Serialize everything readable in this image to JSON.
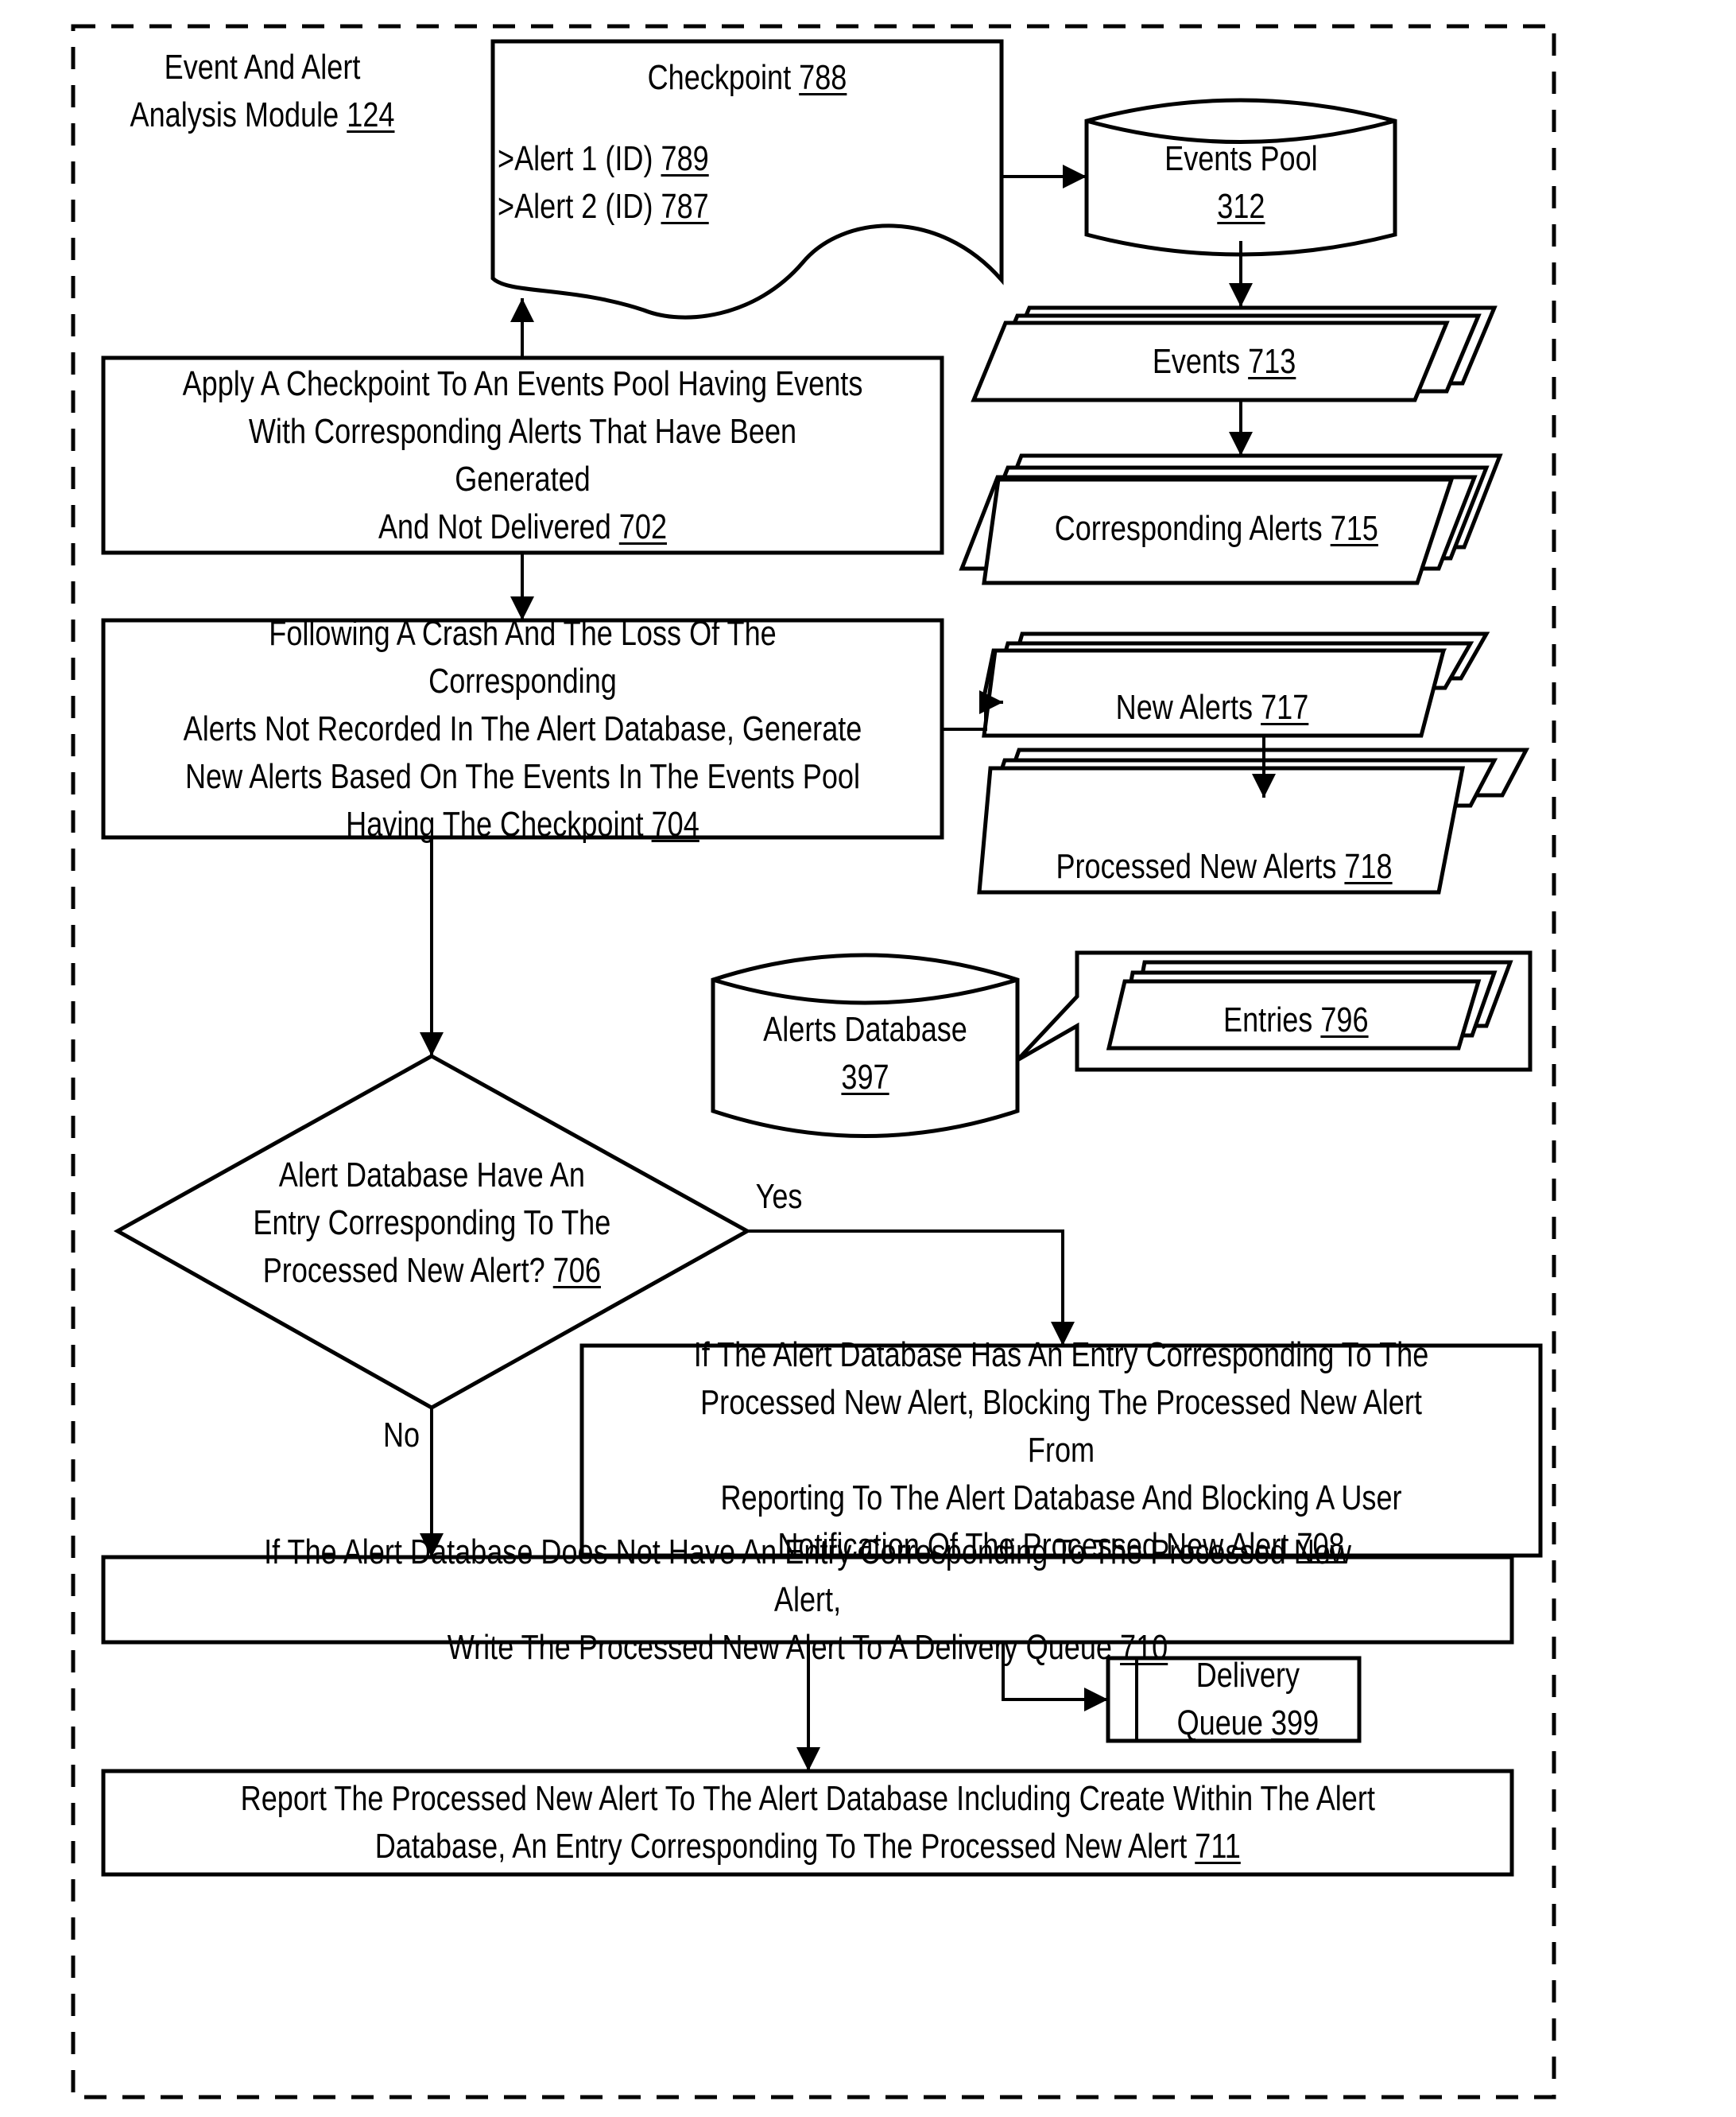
{
  "module": {
    "title_line1": "Event And Alert",
    "title_line2": "Analysis Module",
    "ref": "124"
  },
  "checkpoint": {
    "title": "Checkpoint",
    "ref": "788",
    "items": [
      {
        "label": ">Alert 1 (ID)",
        "ref": "789"
      },
      {
        "label": ">Alert 2 (ID)",
        "ref": "787"
      }
    ]
  },
  "events_pool": {
    "label": "Events Pool",
    "ref": "312"
  },
  "events": {
    "label": "Events",
    "ref": "713"
  },
  "corresponding_alerts": {
    "label": "Corresponding Alerts",
    "ref": "715"
  },
  "new_alerts": {
    "label": "New Alerts",
    "ref": "717"
  },
  "processed_new_alerts": {
    "label": "Processed New Alerts",
    "ref": "718"
  },
  "alerts_database": {
    "label": "Alerts Database",
    "ref": "397"
  },
  "entries": {
    "label": "Entries",
    "ref": "796"
  },
  "steps": {
    "s702": {
      "text": "Apply A Checkpoint To An Events Pool Having Events\nWith Corresponding Alerts That Have Been Generated\nAnd Not Delivered",
      "ref": "702"
    },
    "s704": {
      "text": "Following A Crash And The Loss Of The Corresponding\nAlerts Not Recorded In The Alert Database, Generate\nNew Alerts Based On The Events In The Events Pool\nHaving The Checkpoint",
      "ref": "704"
    },
    "s706": {
      "text": "Alert Database Have An\nEntry Corresponding To The\nProcessed New Alert?",
      "ref": "706"
    },
    "s708": {
      "text": "If The Alert Database Has An Entry Corresponding To The\nProcessed New Alert, Blocking The Processed New Alert From\nReporting To The Alert Database And Blocking A User\nNotification Of The Processed New Alert",
      "ref": "708"
    },
    "s710": {
      "text": "If The Alert Database Does Not Have An Entry Corresponding To The Processed New Alert,\nWrite The Processed New Alert To A Delivery Queue",
      "ref": "710"
    },
    "s711": {
      "text": "Report The Processed New Alert To The Alert Database Including Create Within The Alert\nDatabase, An Entry Corresponding To The Processed New Alert",
      "ref": "711"
    }
  },
  "branches": {
    "yes": "Yes",
    "no": "No"
  },
  "delivery_queue": {
    "line1": "Delivery",
    "line2": "Queue",
    "ref": "399"
  }
}
